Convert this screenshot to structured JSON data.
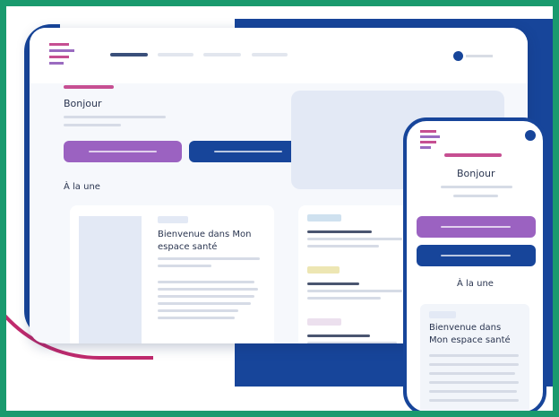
{
  "laptop": {
    "greeting": "Bonjour",
    "section_title": "À la une",
    "card_title_line1": "Bienvenue dans Mon",
    "card_title_line2": "espace santé"
  },
  "phone": {
    "greeting": "Bonjour",
    "section_title": "À la une",
    "card_title_line1": "Bienvenue dans",
    "card_title_line2": "Mon espace santé"
  },
  "colors": {
    "frame": "#1a9a6e",
    "brand_blue": "#17459a",
    "accent_pink": "#c64f92",
    "button_purple": "#9b62c1"
  }
}
